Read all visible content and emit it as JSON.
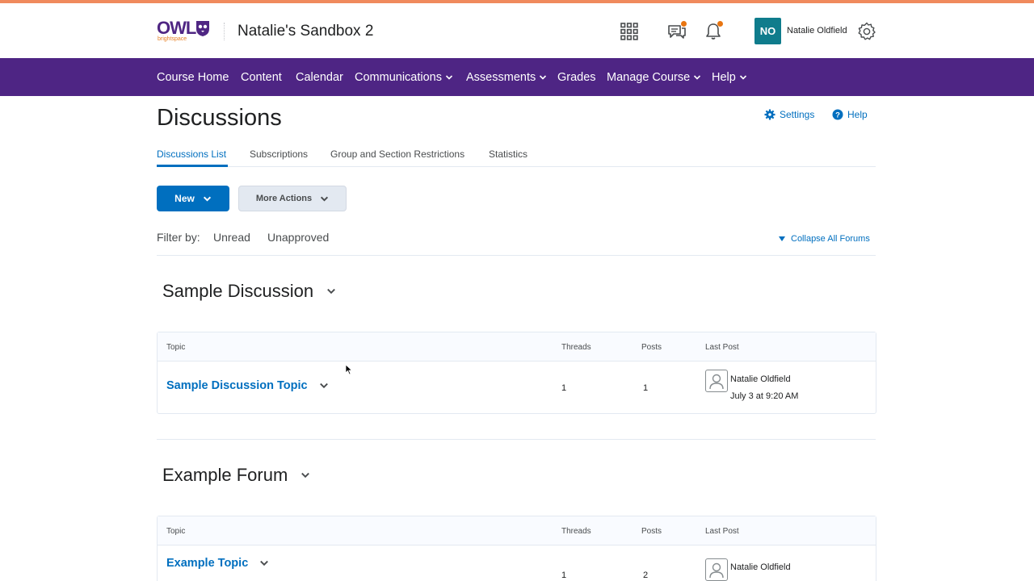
{
  "header": {
    "logo_text": "OWL",
    "logo_sub": "brightspace",
    "course_title": "Natalie's Sandbox 2",
    "icons": [
      "apps-grid-icon",
      "messages-icon",
      "notifications-bell-icon",
      "gear-icon"
    ],
    "avatar_initials": "NO",
    "user_name": "Natalie Oldfield",
    "accent": "#e87511"
  },
  "nav": {
    "background": "#4e2584",
    "items": [
      {
        "label": "Course Home",
        "has_dropdown": false
      },
      {
        "label": "Content",
        "has_dropdown": false
      },
      {
        "label": "Calendar",
        "has_dropdown": false
      },
      {
        "label": "Communications",
        "has_dropdown": true
      },
      {
        "label": "Assessments",
        "has_dropdown": true
      },
      {
        "label": "Grades",
        "has_dropdown": false
      },
      {
        "label": "Manage Course",
        "has_dropdown": true
      },
      {
        "label": "Help",
        "has_dropdown": true
      }
    ]
  },
  "page": {
    "title": "Discussions",
    "settings_label": "Settings",
    "help_label": "Help",
    "tabs": [
      {
        "label": "Discussions List",
        "active": true
      },
      {
        "label": "Subscriptions",
        "active": false
      },
      {
        "label": "Group and Section Restrictions",
        "active": false
      },
      {
        "label": "Statistics",
        "active": false
      }
    ],
    "new_button": "New",
    "more_actions_button": "More Actions",
    "filter_label": "Filter by:",
    "filter_options": [
      "Unread",
      "Unapproved"
    ],
    "collapse_all": "Collapse All Forums"
  },
  "forums": [
    {
      "title": "Sample Discussion",
      "columns": {
        "topic": "Topic",
        "threads": "Threads",
        "posts": "Posts",
        "last_post": "Last Post"
      },
      "topics": [
        {
          "name": "Sample Discussion Topic",
          "threads": "1",
          "posts": "1",
          "last_post_author": "Natalie Oldfield",
          "last_post_date": "July 3 at 9:20 AM"
        }
      ]
    },
    {
      "title": "Example Forum",
      "columns": {
        "topic": "Topic",
        "threads": "Threads",
        "posts": "Posts",
        "last_post": "Last Post"
      },
      "topics": [
        {
          "name": "Example Topic",
          "threads": "1",
          "posts": "2",
          "last_post_author": "Natalie Oldfield",
          "last_post_date": ""
        }
      ]
    }
  ],
  "colors": {
    "link": "#006fbf",
    "primary_button": "#006fbf",
    "top_stripe": "#f08a5d"
  }
}
